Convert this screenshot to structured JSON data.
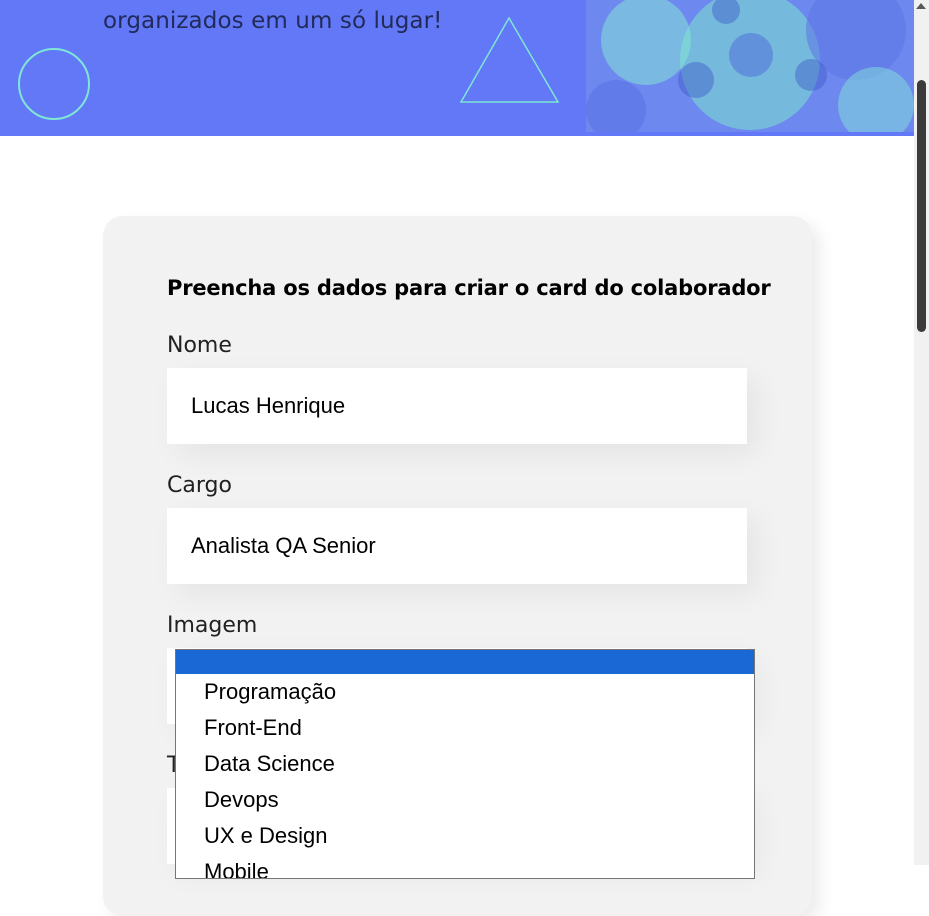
{
  "banner": {
    "text": "organizados em um só lugar!",
    "accent_color": "#6278f7",
    "shape_color": "#7ee6d6"
  },
  "form": {
    "title": "Preencha os dados para criar o card do colaborador",
    "nome": {
      "label": "Nome",
      "value": "Lucas Henrique"
    },
    "cargo": {
      "label": "Cargo",
      "value": "Analista QA Senior"
    },
    "imagem": {
      "label": "Imagem"
    },
    "time": {
      "label_partial": "T"
    }
  },
  "dropdown": {
    "options": [
      "",
      "Programação",
      "Front-End",
      "Data Science",
      "Devops",
      "UX e Design",
      "Mobile"
    ],
    "selected_index": 0,
    "selected_color": "#1a68d6"
  }
}
